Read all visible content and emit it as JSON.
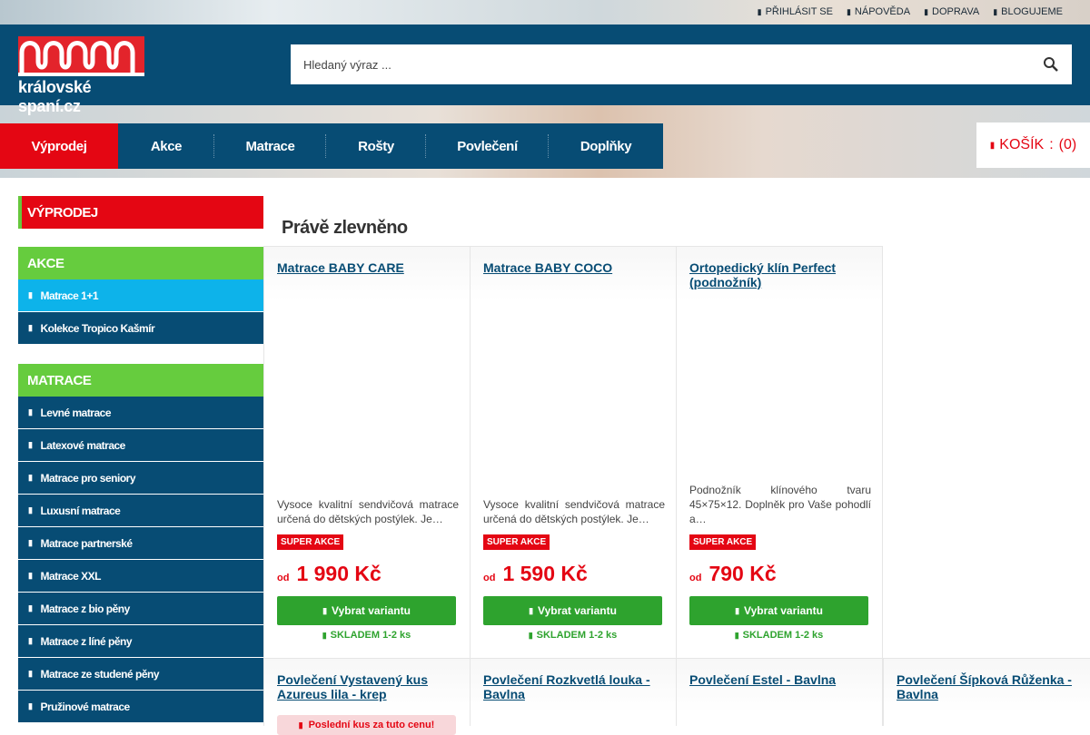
{
  "top_links": [
    {
      "label": "PŘIHLÁSIT SE"
    },
    {
      "label": "NÁPOVĚDA"
    },
    {
      "label": "DOPRAVA"
    },
    {
      "label": "BLOGUJEME"
    }
  ],
  "logo": {
    "text": "královské spaní.cz"
  },
  "search": {
    "placeholder": "Hledaný výraz ..."
  },
  "nav": [
    {
      "label": "Výprodej",
      "active": true
    },
    {
      "label": "Akce"
    },
    {
      "label": "Matrace"
    },
    {
      "label": "Rošty"
    },
    {
      "label": "Povlečení"
    },
    {
      "label": "Doplňky"
    }
  ],
  "cart": {
    "label": "KOŠÍK",
    "count": "(0)"
  },
  "sidebar": {
    "sale": "VÝPRODEJ",
    "akce": {
      "title": "AKCE",
      "items": [
        "Matrace 1+1",
        "Kolekce Tropico Kašmír"
      ]
    },
    "matrace": {
      "title": "MATRACE",
      "items": [
        "Levné matrace",
        "Latexové matrace",
        "Matrace pro seniory",
        "Luxusní matrace",
        "Matrace partnerské",
        "Matrace XXL",
        "Matrace z bio pěny",
        "Matrace z líné pěny",
        "Matrace ze studené pěny",
        "Pružinové matrace"
      ]
    }
  },
  "section_title": "Právě zlevněno",
  "products": [
    {
      "name": "Matrace BABY CARE",
      "desc": "Vysoce kvalitní sendvičová matrace určená do dětských postýlek. Je…",
      "badge": "SUPER AKCE",
      "price_prefix": "od",
      "price": "1 990 Kč",
      "button": "Vybrat variantu",
      "stock": "SKLADEM 1-2 ks"
    },
    {
      "name": "Matrace BABY COCO",
      "desc": "Vysoce kvalitní sendvičová matrace určená do dětských postýlek. Je…",
      "badge": "SUPER AKCE",
      "price_prefix": "od",
      "price": "1 590 Kč",
      "button": "Vybrat variantu",
      "stock": "SKLADEM 1-2 ks"
    },
    {
      "name": "Ortopedický klín Perfect (podnožník)",
      "desc": "Podnožník klínového tvaru 45×75×12. Doplněk pro Vaše pohodlí a…",
      "badge": "SUPER AKCE",
      "price_prefix": "od",
      "price": "790 Kč",
      "button": "Vybrat variantu",
      "stock": "SKLADEM 1-2 ks"
    }
  ],
  "products_row2": [
    {
      "name": "Povlečení Vystavený kus Azureus lila - krep",
      "note": "Poslední kus za tuto cenu!"
    },
    {
      "name": "Povlečení Rozkvetlá louka - Bavlna"
    },
    {
      "name": "Povlečení Estel - Bavlna"
    },
    {
      "name": "Povlečení Šípková Růženka - Bavlna"
    }
  ],
  "colors": {
    "navy": "#074c74",
    "red": "#e40613",
    "green": "#66cc3e",
    "cyan": "#0db3ea",
    "button_green": "#2ea32e"
  }
}
